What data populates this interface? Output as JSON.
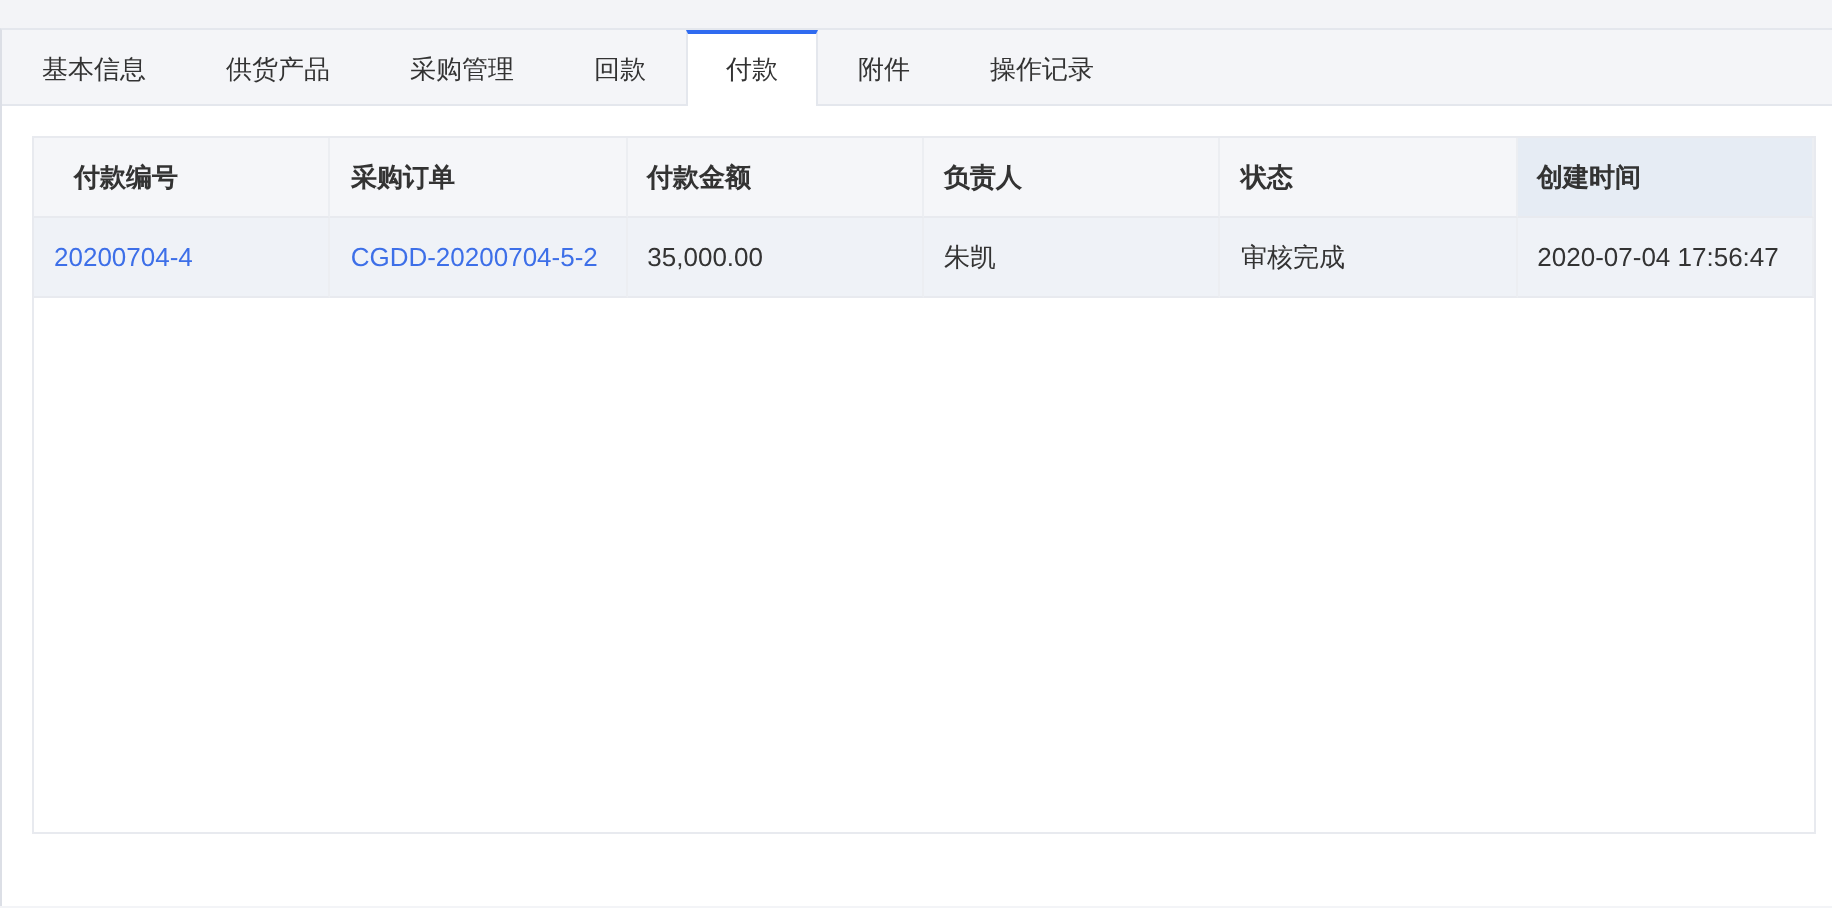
{
  "tabs": [
    {
      "label": "基本信息",
      "selected": false
    },
    {
      "label": "供货产品",
      "selected": false
    },
    {
      "label": "采购管理",
      "selected": false
    },
    {
      "label": "回款",
      "selected": false
    },
    {
      "label": "付款",
      "selected": true
    },
    {
      "label": "附件",
      "selected": false
    },
    {
      "label": "操作记录",
      "selected": false
    }
  ],
  "table": {
    "columns": [
      {
        "label": "付款编号",
        "highlighted": false
      },
      {
        "label": "采购订单",
        "highlighted": false
      },
      {
        "label": "付款金额",
        "highlighted": false
      },
      {
        "label": "负责人",
        "highlighted": false
      },
      {
        "label": "状态",
        "highlighted": false
      },
      {
        "label": "创建时间",
        "highlighted": true
      }
    ],
    "rows": [
      {
        "hovered": true,
        "cells": [
          {
            "text": "20200704-4",
            "kind": "link"
          },
          {
            "text": "CGDD-20200704-5-2",
            "kind": "link"
          },
          {
            "text": "35,000.00",
            "kind": "text"
          },
          {
            "text": "朱凯",
            "kind": "text"
          },
          {
            "text": "审核完成",
            "kind": "text"
          },
          {
            "text": "2020-07-04 17:56:47",
            "kind": "text"
          }
        ]
      }
    ]
  }
}
